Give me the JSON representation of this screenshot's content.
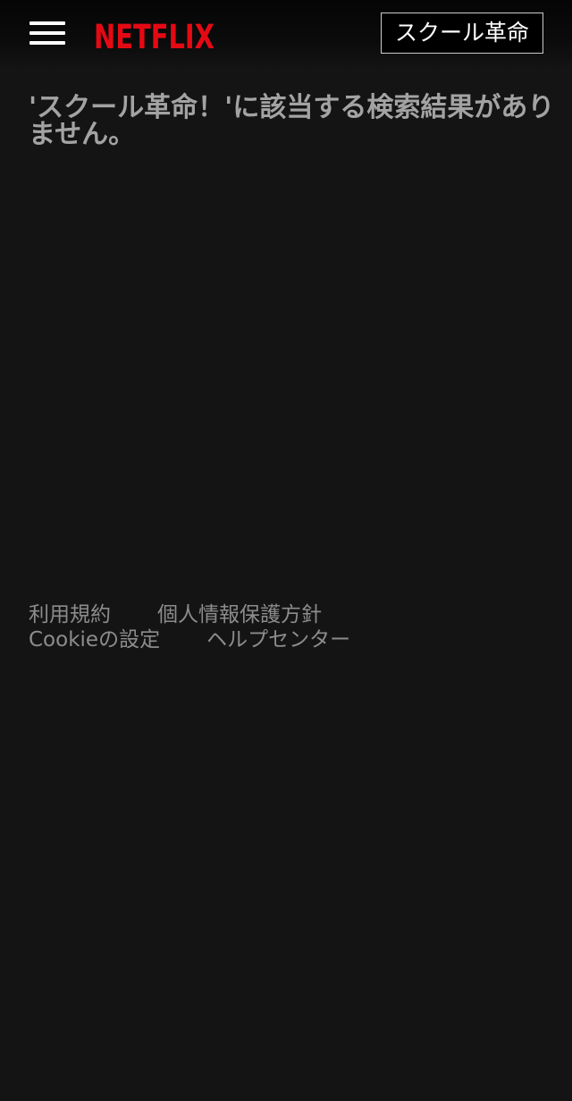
{
  "header": {
    "menu_icon": "hamburger-menu-icon",
    "logo_text": "NETFLIX",
    "logo_color": "#e50914",
    "search_value": "スクール革命"
  },
  "main": {
    "no_results_message": "'スクール革命！'に該当する検索結果がありません。"
  },
  "footer": {
    "links": [
      {
        "label": "利用規約"
      },
      {
        "label": "個人情報保護方針"
      },
      {
        "label": "Cookieの設定"
      },
      {
        "label": "ヘルプセンター"
      }
    ]
  },
  "colors": {
    "background": "#141414",
    "message_text": "#a3a3a3",
    "footer_text": "#8c8c8c"
  }
}
